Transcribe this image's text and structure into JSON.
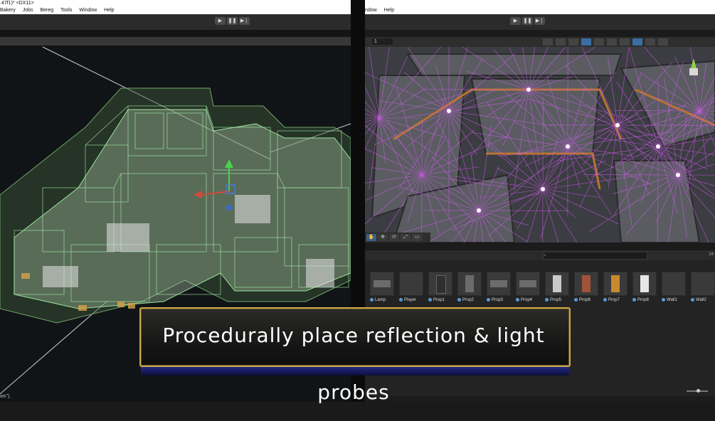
{
  "left_window": {
    "title": ".47f1)* <DX11>",
    "menu": [
      "Bakery",
      "Jobs",
      "Bereg",
      "Tools",
      "Window",
      "Help"
    ],
    "playback": {
      "play_icon": "play-icon",
      "pause_icon": "pause-icon",
      "step_icon": "step-icon"
    },
    "console_snippet": "ws\")."
  },
  "right_window": {
    "menu": [
      "ndow",
      "Help"
    ],
    "layer_field": "1",
    "tools": [
      "hand-icon",
      "move-icon",
      "rotate-icon",
      "scale-icon",
      "rect-icon"
    ],
    "project": {
      "assets": [
        {
          "label": "Lamp",
          "icon": "prefab-icon"
        },
        {
          "label": "Player",
          "icon": "prefab-icon"
        },
        {
          "label": "Prop1",
          "icon": "prefab-icon"
        },
        {
          "label": "Prop2",
          "icon": "prefab-icon"
        },
        {
          "label": "Prop3",
          "icon": "prefab-icon"
        },
        {
          "label": "Prop4",
          "icon": "prefab-icon"
        },
        {
          "label": "Prop5",
          "icon": "prefab-icon"
        },
        {
          "label": "Prop6",
          "icon": "prefab-icon"
        },
        {
          "label": "Prop7",
          "icon": "prefab-icon"
        },
        {
          "label": "Prop8",
          "icon": "prefab-icon"
        },
        {
          "label": "Wall1",
          "icon": "prefab-icon"
        },
        {
          "label": "Wall2",
          "icon": "prefab-icon"
        }
      ],
      "count_badge": "24"
    }
  },
  "caption": "Procedurally place reflection & light probes",
  "colors": {
    "caption_border": "#c9a84a",
    "probe_lines": "#e05cff",
    "volume_green": "#9be39b"
  }
}
